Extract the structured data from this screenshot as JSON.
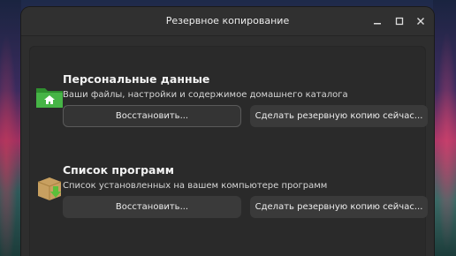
{
  "window": {
    "title": "Резервное копирование"
  },
  "sections": [
    {
      "title": "Персональные данные",
      "description": "Ваши файлы, настройки и содержимое домашнего каталога",
      "icon": "home-folder-icon",
      "restore_label": "Восстановить...",
      "backup_label": "Сделать резервную копию сейчас..."
    },
    {
      "title": "Список программ",
      "description": "Список установленных на вашем компьютере программ",
      "icon": "package-icon",
      "restore_label": "Восстановить...",
      "backup_label": "Сделать резервную копию сейчас..."
    }
  ],
  "colors": {
    "window_bg": "#2e2e2e",
    "button_bg": "#3a3a3a",
    "folder_green": "#3aa83a",
    "package_tan": "#c8a060"
  }
}
